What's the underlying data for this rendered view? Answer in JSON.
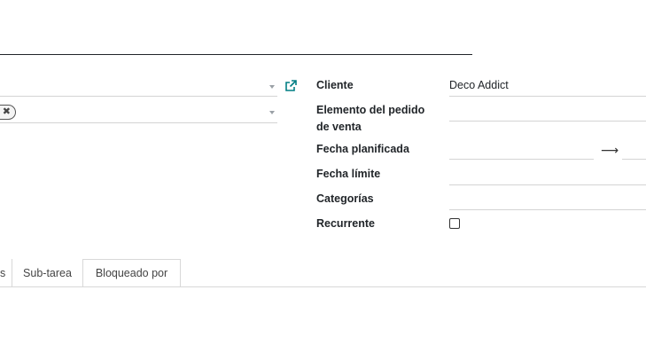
{
  "form": {
    "client_label": "Cliente",
    "client_value": "Deco Addict",
    "sale_line_label_1": "Elemento del pedido",
    "sale_line_label_2": "de venta",
    "planned_date_label": "Fecha planificada",
    "date_range_arrow": "⟶",
    "deadline_label": "Fecha límite",
    "categories_label": "Categorías",
    "recurrent_label": "Recurrente",
    "recurrent_checked": false
  },
  "tag": {
    "remove_glyph": "✖"
  },
  "tabs": [
    {
      "label": "s"
    },
    {
      "label": "Sub-tarea"
    },
    {
      "label": "Bloqueado por"
    }
  ],
  "icons": {
    "external_link": "external-link-icon",
    "dropdown": "caret-down-icon"
  },
  "colors": {
    "accent": "#017e84",
    "text": "#212529",
    "border": "#d4d4d4"
  }
}
